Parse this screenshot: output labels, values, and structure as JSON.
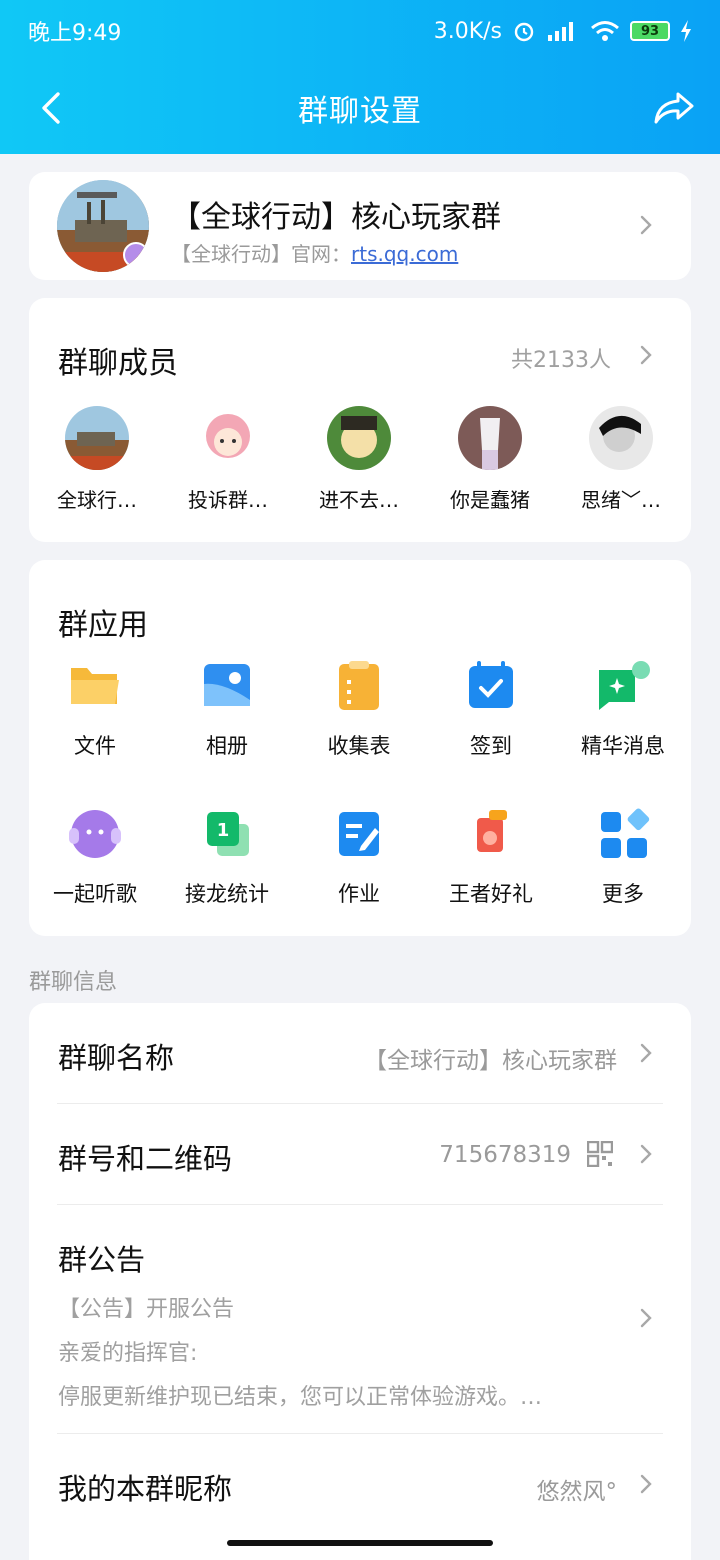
{
  "status": {
    "time": "晚上9:49",
    "net_speed": "3.0K/s",
    "battery": "93"
  },
  "nav": {
    "title": "群聊设置"
  },
  "group": {
    "name": "【全球行动】核心玩家群",
    "subtitle_prefix": "【全球行动】官网：",
    "subtitle_link": "rts.qq.com"
  },
  "members": {
    "title": "群聊成员",
    "count": "共2133人",
    "list": [
      {
        "name": "全球行…"
      },
      {
        "name": "投诉群…"
      },
      {
        "name": "进不去…"
      },
      {
        "name": "你是蠢猪"
      },
      {
        "name": "思绪﹀…"
      }
    ]
  },
  "apps": {
    "title": "群应用",
    "items": [
      {
        "label": "文件",
        "icon": "folder-icon"
      },
      {
        "label": "相册",
        "icon": "album-icon"
      },
      {
        "label": "收集表",
        "icon": "form-icon"
      },
      {
        "label": "签到",
        "icon": "checkin-icon"
      },
      {
        "label": "精华消息",
        "icon": "highlight-icon"
      },
      {
        "label": "一起听歌",
        "icon": "music-icon"
      },
      {
        "label": "接龙统计",
        "icon": "relay-icon"
      },
      {
        "label": "作业",
        "icon": "homework-icon"
      },
      {
        "label": "王者好礼",
        "icon": "gift-icon"
      },
      {
        "label": "更多",
        "icon": "more-icon"
      }
    ]
  },
  "info": {
    "section_label": "群聊信息",
    "group_name_label": "群聊名称",
    "group_name_value": "【全球行动】核心玩家群",
    "group_id_label": "群号和二维码",
    "group_id_value": "715678319",
    "notice_label": "群公告",
    "notice_lines": [
      "【公告】开服公告",
      "亲爱的指挥官:",
      "停服更新维护现已结束，您可以正常体验游戏。…"
    ],
    "nickname_label": "我的本群昵称",
    "nickname_value": "悠然风°"
  },
  "colors": {
    "header_start": "#10c8f6",
    "header_end": "#0aa2f5",
    "link": "#3b6bd6"
  }
}
